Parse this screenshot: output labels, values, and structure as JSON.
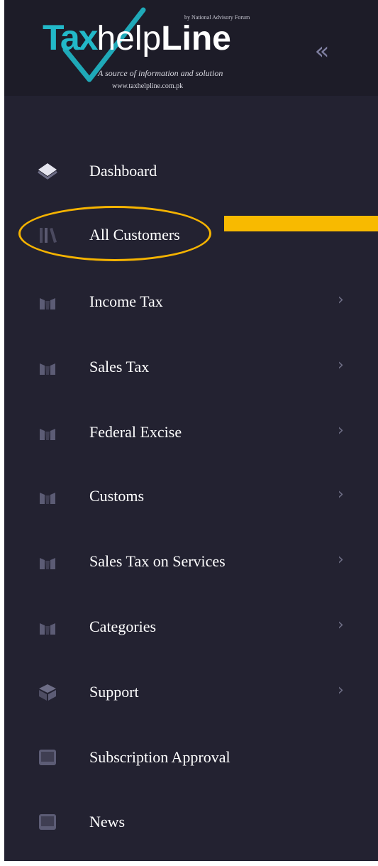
{
  "header": {
    "logo_byline": "by National Advisory Forum",
    "logo_tax": "Tax",
    "logo_help": "help",
    "logo_line": "Line",
    "logo_tagline": "A source of information and solution",
    "logo_url": "www.taxhelpline.com.pk",
    "collapse_glyph": "«"
  },
  "sidebar": {
    "items": [
      {
        "label": "Dashboard",
        "icon": "layers-icon",
        "has_submenu": false
      },
      {
        "label": "All Customers",
        "icon": "library-icon",
        "has_submenu": false
      },
      {
        "label": "Income Tax",
        "icon": "chart-icon",
        "has_submenu": true
      },
      {
        "label": "Sales Tax",
        "icon": "chart-icon",
        "has_submenu": true
      },
      {
        "label": "Federal Excise",
        "icon": "chart-icon",
        "has_submenu": true
      },
      {
        "label": "Customs",
        "icon": "chart-icon",
        "has_submenu": true
      },
      {
        "label": "Sales Tax on Services",
        "icon": "chart-icon",
        "has_submenu": true
      },
      {
        "label": "Categories",
        "icon": "chart-icon",
        "has_submenu": true
      },
      {
        "label": "Support",
        "icon": "box-icon",
        "has_submenu": true
      },
      {
        "label": "Subscription Approval",
        "icon": "monitor-icon",
        "has_submenu": false
      },
      {
        "label": "News",
        "icon": "monitor-icon",
        "has_submenu": false
      }
    ],
    "chevron_glyph": "›"
  },
  "colors": {
    "sidebar_bg": "#232231",
    "header_bg": "#1d1c28",
    "text": "#ffffff",
    "icon": "#5c5c75",
    "accent_logo": "#22b8c8",
    "highlight": "#f5b300"
  },
  "annotation": {
    "highlighted_item": "All Customers"
  }
}
